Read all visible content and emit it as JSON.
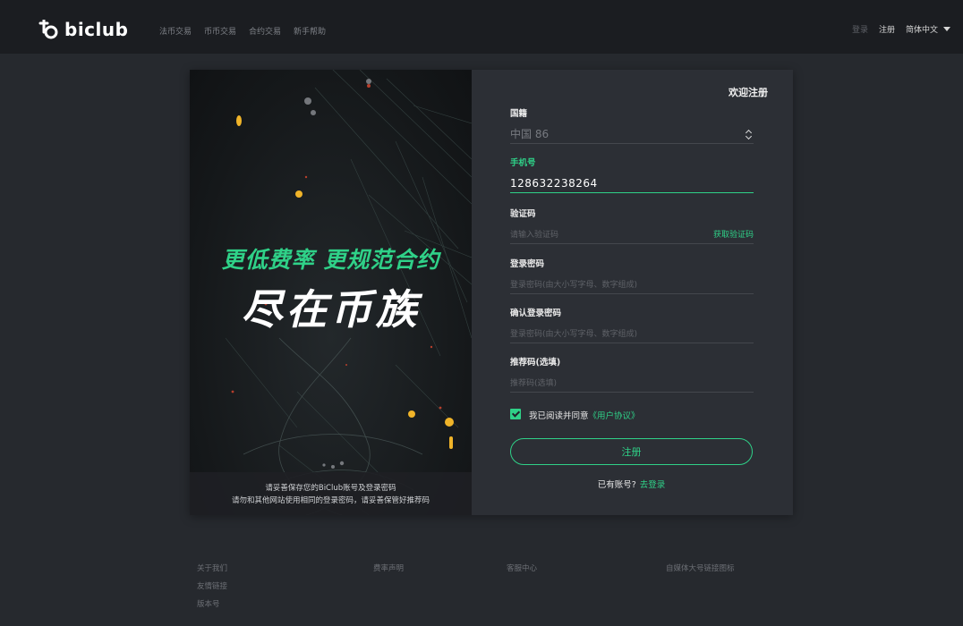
{
  "nav": {
    "logo_text": "biclub",
    "links": [
      "法币交易",
      "币币交易",
      "合约交易",
      "新手帮助"
    ],
    "login": "登录",
    "register": "注册",
    "language": "简体中文"
  },
  "banner": {
    "slogan_line1": "更低费率 更规范合约",
    "slogan_line2": "尽在币族",
    "notice_line1": "请妥善保存您的BiClub账号及登录密码",
    "notice_line2": "请勿和其他网站使用相同的登录密码，请妥善保管好推荐码"
  },
  "form": {
    "title": "欢迎注册",
    "nationality": {
      "label": "国籍",
      "value": "中国  86"
    },
    "phone": {
      "label": "手机号",
      "value": "128632238264"
    },
    "code": {
      "label": "验证码",
      "placeholder": "请输入验证码",
      "action": "获取验证码"
    },
    "password": {
      "label": "登录密码",
      "placeholder": "登录密码(由大小写字母、数字组成)"
    },
    "confirm_password": {
      "label": "确认登录密码",
      "placeholder": "登录密码(由大小写字母、数字组成)"
    },
    "referral": {
      "label": "推荐码(选填)",
      "placeholder": "推荐码(选填)"
    },
    "agreement_text": "我已阅读并同意",
    "agreement_link": "《用户协议》",
    "agreement_checked": true,
    "submit": "注册",
    "has_account": "已有账号?",
    "go_login": "去登录"
  },
  "footer": {
    "col1": [
      "关于我们",
      "友情链接",
      "版本号"
    ],
    "col2": [
      "费率声明"
    ],
    "col3": [
      "客服中心"
    ],
    "col4": [
      "自媒体大号链接图标"
    ]
  },
  "colors": {
    "accent": "#2fd188",
    "background": "#26292e",
    "nav": "#1b1d21",
    "card": "#2c2f35"
  }
}
